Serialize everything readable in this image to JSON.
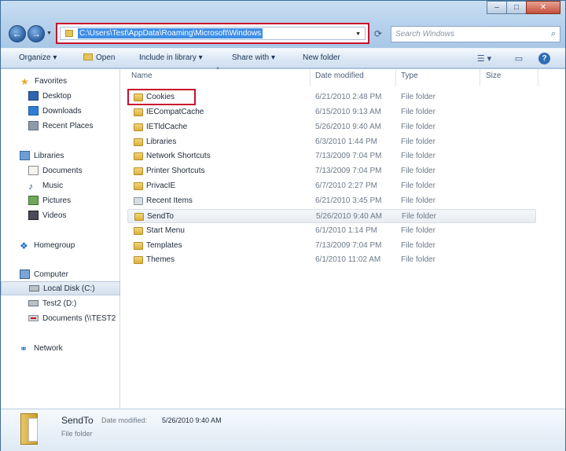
{
  "window": {
    "minimize_glyph": "–",
    "maximize_glyph": "□",
    "close_glyph": "✕"
  },
  "address_bar": {
    "path": "C:\\Users\\Test\\AppData\\Roaming\\Microsoft\\Windows",
    "search_placeholder": "Search Windows"
  },
  "toolbar": {
    "organize": "Organize ▾",
    "open": "Open",
    "include_in_library": "Include in library ▾",
    "share_with": "Share with ▾",
    "new_folder": "New folder"
  },
  "nav": {
    "favorites": "Favorites",
    "desktop": "Desktop",
    "downloads": "Downloads",
    "recent_places": "Recent Places",
    "libraries": "Libraries",
    "documents": "Documents",
    "music": "Music",
    "pictures": "Pictures",
    "videos": "Videos",
    "homegroup": "Homegroup",
    "computer": "Computer",
    "local_disk": "Local Disk (C:)",
    "test2": "Test2 (D:)",
    "documents_net": "Documents (\\\\TEST2",
    "network": "Network"
  },
  "columns": {
    "name": "Name",
    "date_modified": "Date modified",
    "type": "Type",
    "size": "Size"
  },
  "files": [
    {
      "name": "Cookies",
      "date": "6/21/2010 2:48 PM",
      "type": "File folder"
    },
    {
      "name": "IECompatCache",
      "date": "6/15/2010 9:13 AM",
      "type": "File folder"
    },
    {
      "name": "IETldCache",
      "date": "5/26/2010 9:40 AM",
      "type": "File folder"
    },
    {
      "name": "Libraries",
      "date": "6/3/2010 1:44 PM",
      "type": "File folder"
    },
    {
      "name": "Network Shortcuts",
      "date": "7/13/2009 7:04 PM",
      "type": "File folder"
    },
    {
      "name": "Printer Shortcuts",
      "date": "7/13/2009 7:04 PM",
      "type": "File folder"
    },
    {
      "name": "PrivacIE",
      "date": "6/7/2010 2:27 PM",
      "type": "File folder"
    },
    {
      "name": "Recent Items",
      "date": "6/21/2010 3:45 PM",
      "type": "File folder"
    },
    {
      "name": "SendTo",
      "date": "5/26/2010 9:40 AM",
      "type": "File folder"
    },
    {
      "name": "Start Menu",
      "date": "6/1/2010 1:14 PM",
      "type": "File folder"
    },
    {
      "name": "Templates",
      "date": "7/13/2009 7:04 PM",
      "type": "File folder"
    },
    {
      "name": "Themes",
      "date": "6/1/2010 11:02 AM",
      "type": "File folder"
    }
  ],
  "details": {
    "name": "SendTo",
    "date_label": "Date modified:",
    "date_value": "5/26/2010 9:40 AM",
    "type": "File folder"
  }
}
